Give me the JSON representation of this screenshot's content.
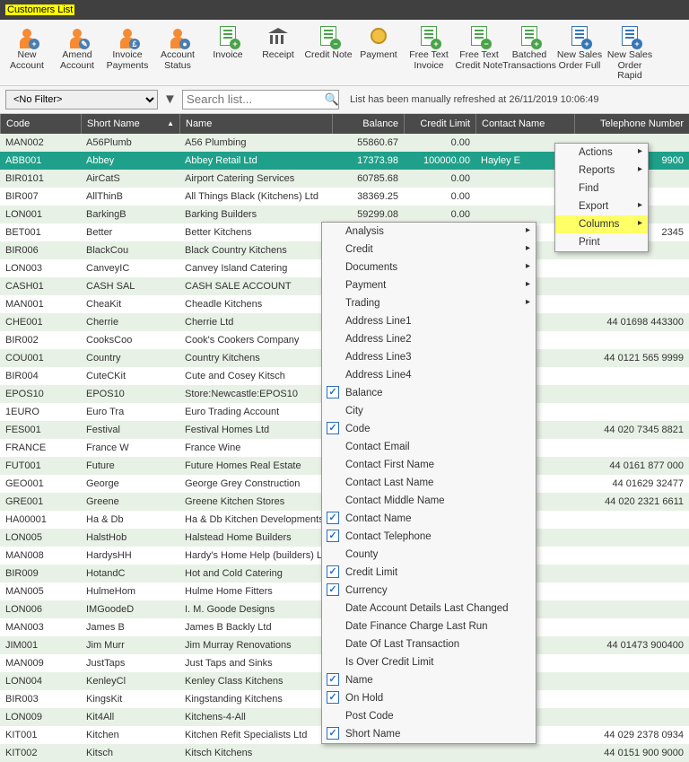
{
  "window_title": "Customers List",
  "toolbar": [
    {
      "label": "New Account",
      "icon": "person-plus"
    },
    {
      "label": "Amend Account",
      "icon": "person-edit"
    },
    {
      "label": "Invoice Payments",
      "icon": "person-coin"
    },
    {
      "label": "Account Status",
      "icon": "person-status"
    },
    {
      "label": "Invoice",
      "icon": "doc-plus-green"
    },
    {
      "label": "Receipt",
      "icon": "bank"
    },
    {
      "label": "Credit Note",
      "icon": "doc-minus-green"
    },
    {
      "label": "Payment",
      "icon": "coin"
    },
    {
      "label": "Free Text Invoice",
      "icon": "doc-plus-green"
    },
    {
      "label": "Free Text Credit Note",
      "icon": "doc-minus-green"
    },
    {
      "label": "Batched Transactions",
      "icon": "doc-green"
    },
    {
      "label": "New Sales Order Full",
      "icon": "doc-blue"
    },
    {
      "label": "New Sales Order Rapid",
      "icon": "doc-blue"
    }
  ],
  "filter": {
    "value": "<No Filter>",
    "search_placeholder": "Search list..."
  },
  "status_text": "List has been manually refreshed at 26/11/2019 10:06:49",
  "columns": [
    "Code",
    "Short Name",
    "Name",
    "Balance",
    "Credit Limit",
    "Contact Name",
    "Telephone Number"
  ],
  "rows": [
    {
      "code": "MAN002",
      "short": "A56Plumb",
      "name": "A56 Plumbing",
      "bal": "55860.67",
      "lim": "0.00",
      "contact": "",
      "tel": ""
    },
    {
      "code": "ABB001",
      "short": "Abbey",
      "name": "Abbey Retail Ltd",
      "bal": "17373.98",
      "lim": "100000.00",
      "contact": "Hayley E",
      "tel": "9900",
      "selected": true
    },
    {
      "code": "BIR0101",
      "short": "AirCatS",
      "name": "Airport Catering Services",
      "bal": "60785.68",
      "lim": "0.00",
      "contact": "",
      "tel": ""
    },
    {
      "code": "BIR007",
      "short": "AllThinB",
      "name": "All Things Black (Kitchens) Ltd",
      "bal": "38369.25",
      "lim": "0.00",
      "contact": "",
      "tel": ""
    },
    {
      "code": "LON001",
      "short": "BarkingB",
      "name": "Barking Builders",
      "bal": "59299.08",
      "lim": "0.00",
      "contact": "",
      "tel": ""
    },
    {
      "code": "BET001",
      "short": "Better",
      "name": "Better Kitchens",
      "bal": "",
      "lim": "",
      "contact": "",
      "tel": "2345"
    },
    {
      "code": "BIR006",
      "short": "BlackCou",
      "name": "Black Country Kitchens",
      "bal": "",
      "lim": "",
      "contact": "",
      "tel": ""
    },
    {
      "code": "LON003",
      "short": "CanveyIC",
      "name": "Canvey Island Catering",
      "bal": "",
      "lim": "",
      "contact": "",
      "tel": ""
    },
    {
      "code": "CASH01",
      "short": "CASH SAL",
      "name": "CASH SALE ACCOUNT",
      "bal": "",
      "lim": "",
      "contact": "",
      "tel": ""
    },
    {
      "code": "MAN001",
      "short": "CheaKit",
      "name": "Cheadle Kitchens",
      "bal": "",
      "lim": "",
      "contact": "",
      "tel": ""
    },
    {
      "code": "CHE001",
      "short": "Cherrie",
      "name": "Cherrie Ltd",
      "bal": "",
      "lim": "",
      "contact": "vis",
      "tel": "44 01698 443300"
    },
    {
      "code": "BIR002",
      "short": "CooksCoo",
      "name": "Cook's Cookers Company",
      "bal": "",
      "lim": "",
      "contact": "",
      "tel": ""
    },
    {
      "code": "COU001",
      "short": "Country",
      "name": "Country Kitchens",
      "bal": "",
      "lim": "",
      "contact": "",
      "tel": "44 0121 565 9999"
    },
    {
      "code": "BIR004",
      "short": "CuteCKit",
      "name": "Cute and Cosey Kitsch",
      "bal": "",
      "lim": "",
      "contact": "",
      "tel": ""
    },
    {
      "code": "EPOS10",
      "short": "EPOS10",
      "name": "Store:Newcastle:EPOS10",
      "bal": "",
      "lim": "",
      "contact": "",
      "tel": ""
    },
    {
      "code": "1EURO",
      "short": "Euro Tra",
      "name": "Euro Trading Account",
      "bal": "",
      "lim": "",
      "contact": "",
      "tel": ""
    },
    {
      "code": "FES001",
      "short": "Festival",
      "name": "Festival Homes Ltd",
      "bal": "",
      "lim": "",
      "contact": "Duffy",
      "tel": "44 020 7345 8821"
    },
    {
      "code": "FRANCE",
      "short": "France W",
      "name": "France Wine",
      "bal": "",
      "lim": "",
      "contact": "",
      "tel": ""
    },
    {
      "code": "FUT001",
      "short": "Future",
      "name": "Future Homes Real Estate",
      "bal": "",
      "lim": "",
      "contact": "e Jansen",
      "tel": "44 0161 877 000"
    },
    {
      "code": "GEO001",
      "short": "George",
      "name": "George Grey Construction",
      "bal": "",
      "lim": "",
      "contact": "w",
      "tel": "44 01629 32477"
    },
    {
      "code": "GRE001",
      "short": "Greene",
      "name": "Greene Kitchen Stores",
      "bal": "",
      "lim": "",
      "contact": "French",
      "tel": "44 020 2321 6611"
    },
    {
      "code": "HA00001",
      "short": "Ha & Db",
      "name": "Ha & Db Kitchen Developments",
      "bal": "",
      "lim": "",
      "contact": "ellyn",
      "tel": ""
    },
    {
      "code": "LON005",
      "short": "HalstHob",
      "name": "Halstead Home Builders",
      "bal": "",
      "lim": "",
      "contact": "",
      "tel": ""
    },
    {
      "code": "MAN008",
      "short": "HardysHH",
      "name": "Hardy's Home Help (builders) L",
      "bal": "",
      "lim": "",
      "contact": "",
      "tel": ""
    },
    {
      "code": "BIR009",
      "short": "HotandC",
      "name": "Hot and Cold Catering",
      "bal": "",
      "lim": "",
      "contact": "",
      "tel": ""
    },
    {
      "code": "MAN005",
      "short": "HulmeHom",
      "name": "Hulme Home Fitters",
      "bal": "",
      "lim": "",
      "contact": "",
      "tel": ""
    },
    {
      "code": "LON006",
      "short": "IMGoodeD",
      "name": "I. M. Goode Designs",
      "bal": "",
      "lim": "",
      "contact": "",
      "tel": ""
    },
    {
      "code": "MAN003",
      "short": "James B",
      "name": "James B Backly Ltd",
      "bal": "",
      "lim": "",
      "contact": "",
      "tel": ""
    },
    {
      "code": "JIM001",
      "short": "Jim Murr",
      "name": "Jim Murray Renovations",
      "bal": "",
      "lim": "",
      "contact": "ay",
      "tel": "44 01473 900400"
    },
    {
      "code": "MAN009",
      "short": "JustTaps",
      "name": "Just Taps and Sinks",
      "bal": "",
      "lim": "",
      "contact": "",
      "tel": ""
    },
    {
      "code": "LON004",
      "short": "KenleyCl",
      "name": "Kenley Class Kitchens",
      "bal": "",
      "lim": "",
      "contact": "",
      "tel": ""
    },
    {
      "code": "BIR003",
      "short": "KingsKit",
      "name": "Kingstanding Kitchens",
      "bal": "",
      "lim": "",
      "contact": "",
      "tel": ""
    },
    {
      "code": "LON009",
      "short": "Kit4All",
      "name": "Kitchens-4-All",
      "bal": "",
      "lim": "",
      "contact": "",
      "tel": ""
    },
    {
      "code": "KIT001",
      "short": "Kitchen",
      "name": "Kitchen Refit Specialists Ltd",
      "bal": "",
      "lim": "",
      "contact": "in",
      "tel": "44 029 2378 0934"
    },
    {
      "code": "KIT002",
      "short": "Kitsch",
      "name": "Kitsch Kitchens",
      "bal": "",
      "lim": "",
      "contact": "",
      "tel": "44 0151 900 9000"
    }
  ],
  "context_menu_main": [
    {
      "label": "Actions",
      "arrow": true
    },
    {
      "label": "Reports",
      "arrow": true
    },
    {
      "label": "Find"
    },
    {
      "label": "Export",
      "arrow": true
    },
    {
      "label": "Columns",
      "arrow": true,
      "hl": true
    },
    {
      "label": "Print"
    }
  ],
  "context_menu_sub_top": [
    {
      "label": "Analysis",
      "arrow": true
    },
    {
      "label": "Credit",
      "arrow": true
    },
    {
      "label": "Documents",
      "arrow": true
    },
    {
      "label": "Payment",
      "arrow": true
    },
    {
      "label": "Trading",
      "arrow": true
    }
  ],
  "context_menu_sub_cols": [
    {
      "label": "Address Line1",
      "checked": false
    },
    {
      "label": "Address Line2",
      "checked": false
    },
    {
      "label": "Address Line3",
      "checked": false
    },
    {
      "label": "Address Line4",
      "checked": false
    },
    {
      "label": "Balance",
      "checked": true
    },
    {
      "label": "City",
      "checked": false
    },
    {
      "label": "Code",
      "checked": true
    },
    {
      "label": "Contact Email",
      "checked": false
    },
    {
      "label": "Contact First Name",
      "checked": false
    },
    {
      "label": "Contact Last Name",
      "checked": false
    },
    {
      "label": "Contact Middle Name",
      "checked": false
    },
    {
      "label": "Contact Name",
      "checked": true
    },
    {
      "label": "Contact Telephone",
      "checked": true
    },
    {
      "label": "County",
      "checked": false
    },
    {
      "label": "Credit Limit",
      "checked": true
    },
    {
      "label": "Currency",
      "checked": true
    },
    {
      "label": "Date Account Details Last Changed",
      "checked": false
    },
    {
      "label": "Date Finance Charge Last Run",
      "checked": false
    },
    {
      "label": "Date Of Last Transaction",
      "checked": false
    },
    {
      "label": "Is Over Credit Limit",
      "checked": false
    },
    {
      "label": "Name",
      "checked": true
    },
    {
      "label": "On Hold",
      "checked": true
    },
    {
      "label": "Post Code",
      "checked": false
    },
    {
      "label": "Short Name",
      "checked": true
    }
  ]
}
